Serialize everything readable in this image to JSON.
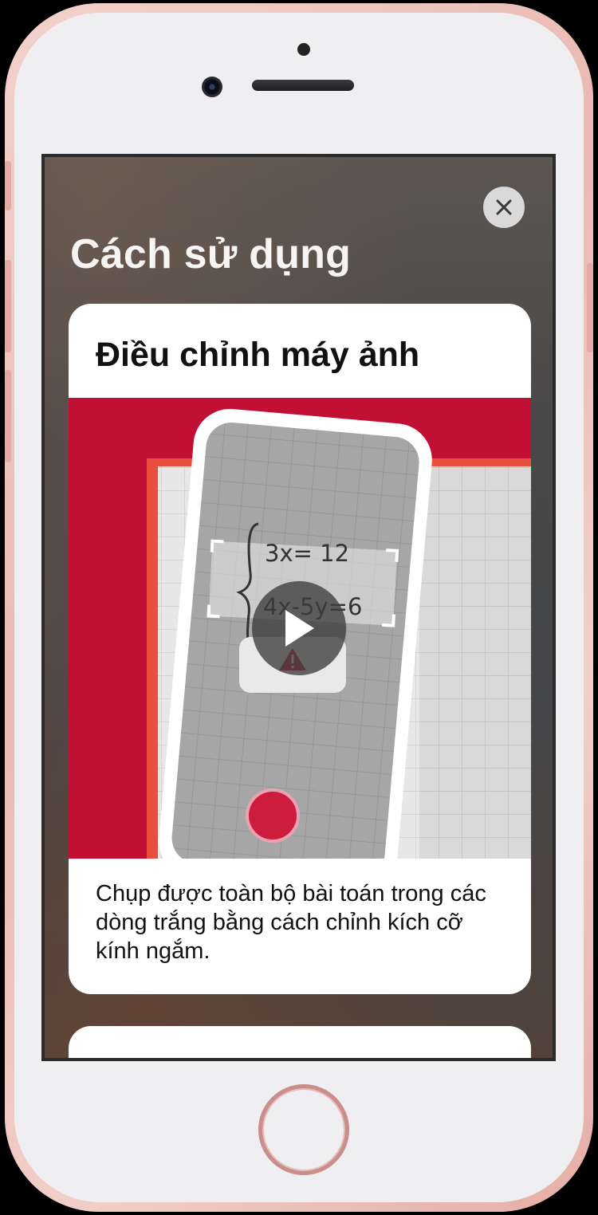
{
  "header": {
    "title": "Cách sử dụng",
    "close_icon": "close-icon"
  },
  "tutorial_card": {
    "title": "Điều chỉnh máy ảnh",
    "description": "Chụp được toàn bộ bài toán trong các dòng trắng bằng cách chỉnh kích cỡ kính ngắm.",
    "media": {
      "equation_line_1": "3x= 12",
      "equation_line_2": "4x-5y=6",
      "play_icon": "play-icon",
      "warning_icon": "warning-icon",
      "shutter_icon": "shutter-button-icon"
    }
  },
  "colors": {
    "media_background": "#c20f34",
    "accent_red": "#cc1d3e",
    "notebook_border": "#e6503d"
  }
}
